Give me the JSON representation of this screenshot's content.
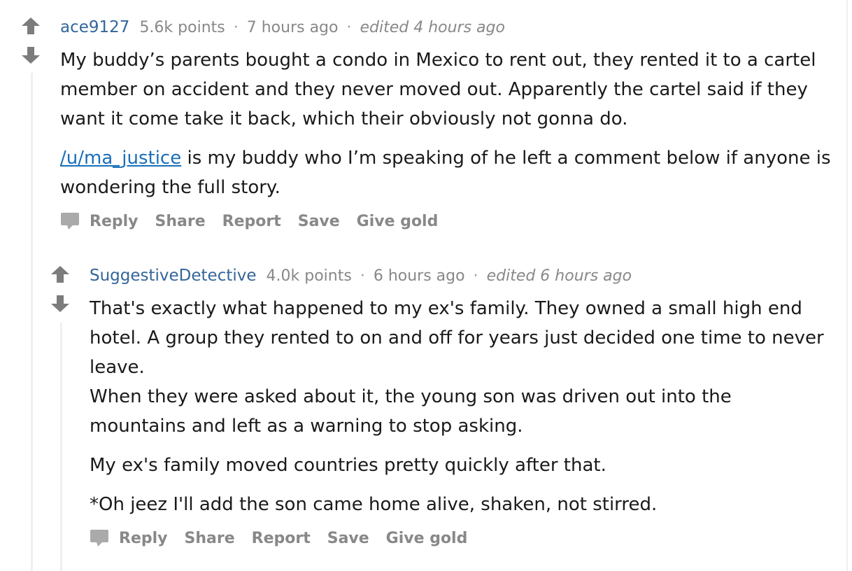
{
  "colors": {
    "arrow": "#7c7c7c",
    "author": "#336699",
    "link": "#1a6fb8",
    "meta": "#888888",
    "text": "#1a1a1b",
    "thread_line": "#edeff1"
  },
  "icons": {
    "upvote": "upvote-arrow-icon",
    "downvote": "downvote-arrow-icon",
    "reply": "speech-bubble-icon"
  },
  "comments": [
    {
      "author": "ace9127",
      "points": "5.6k points",
      "time": "7 hours ago",
      "separator": "·",
      "edited": "edited 4 hours ago",
      "paragraphs": [
        "My buddy’s parents bought a condo in Mexico to rent out, they rented it to a cartel member on accident and they never moved out. Apparently the cartel said if they want it come take it back, which their obviously not gonna do."
      ],
      "link_paragraph": {
        "link_text": "/u/ma_justice",
        "after_text": " is my buddy who I’m speaking of he left a comment below if anyone is wondering the full story."
      },
      "actions": [
        "Reply",
        "Share",
        "Report",
        "Save",
        "Give gold"
      ]
    },
    {
      "author": "SuggestiveDetective",
      "points": "4.0k points",
      "time": "6 hours ago",
      "separator": "·",
      "edited": "edited 6 hours ago",
      "paragraphs": [
        "That's exactly what happened to my ex's family. They owned a small high end hotel. A group they rented to on and off for years just decided one time to never leave.",
        "When they were asked about it, the young son was driven out into the mountains and left as a warning to stop asking.",
        "My ex's family moved countries pretty quickly after that.",
        "*Oh jeez I'll add the son came home alive, shaken, not stirred."
      ],
      "actions": [
        "Reply",
        "Share",
        "Report",
        "Save",
        "Give gold"
      ]
    }
  ]
}
